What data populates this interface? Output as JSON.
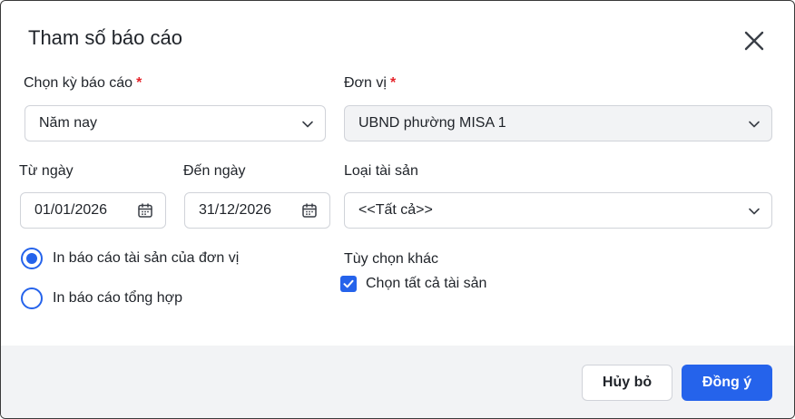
{
  "dialog": {
    "title": "Tham số báo cáo"
  },
  "period": {
    "label": "Chọn kỳ báo cáo",
    "required_mark": "*",
    "value": "Năm nay"
  },
  "unit": {
    "label": "Đơn vị",
    "required_mark": "*",
    "value": "UBND phường MISA 1"
  },
  "from_date": {
    "label": "Từ ngày",
    "value": "01/01/2026"
  },
  "to_date": {
    "label": "Đến ngày",
    "value": "31/12/2026"
  },
  "asset_type": {
    "label": "Loại tài sản",
    "value": "<<Tất cả>>"
  },
  "report_options": {
    "items": [
      {
        "label": "In báo cáo tài sản của đơn vị",
        "checked": true
      },
      {
        "label": "In báo cáo tổng hợp",
        "checked": false
      }
    ]
  },
  "other_options": {
    "label": "Tùy chọn khác",
    "select_all_label": "Chọn tất cả tài sản",
    "select_all_checked": true
  },
  "footer": {
    "cancel_label": "Hủy bỏ",
    "ok_label": "Đồng ý"
  },
  "colors": {
    "accent": "#2563eb",
    "required": "#e5242b",
    "footer_bg": "#f2f3f5"
  },
  "icons": {
    "close": "close-icon",
    "chevron": "chevron-down-icon",
    "calendar": "calendar-icon",
    "check": "check-icon"
  }
}
